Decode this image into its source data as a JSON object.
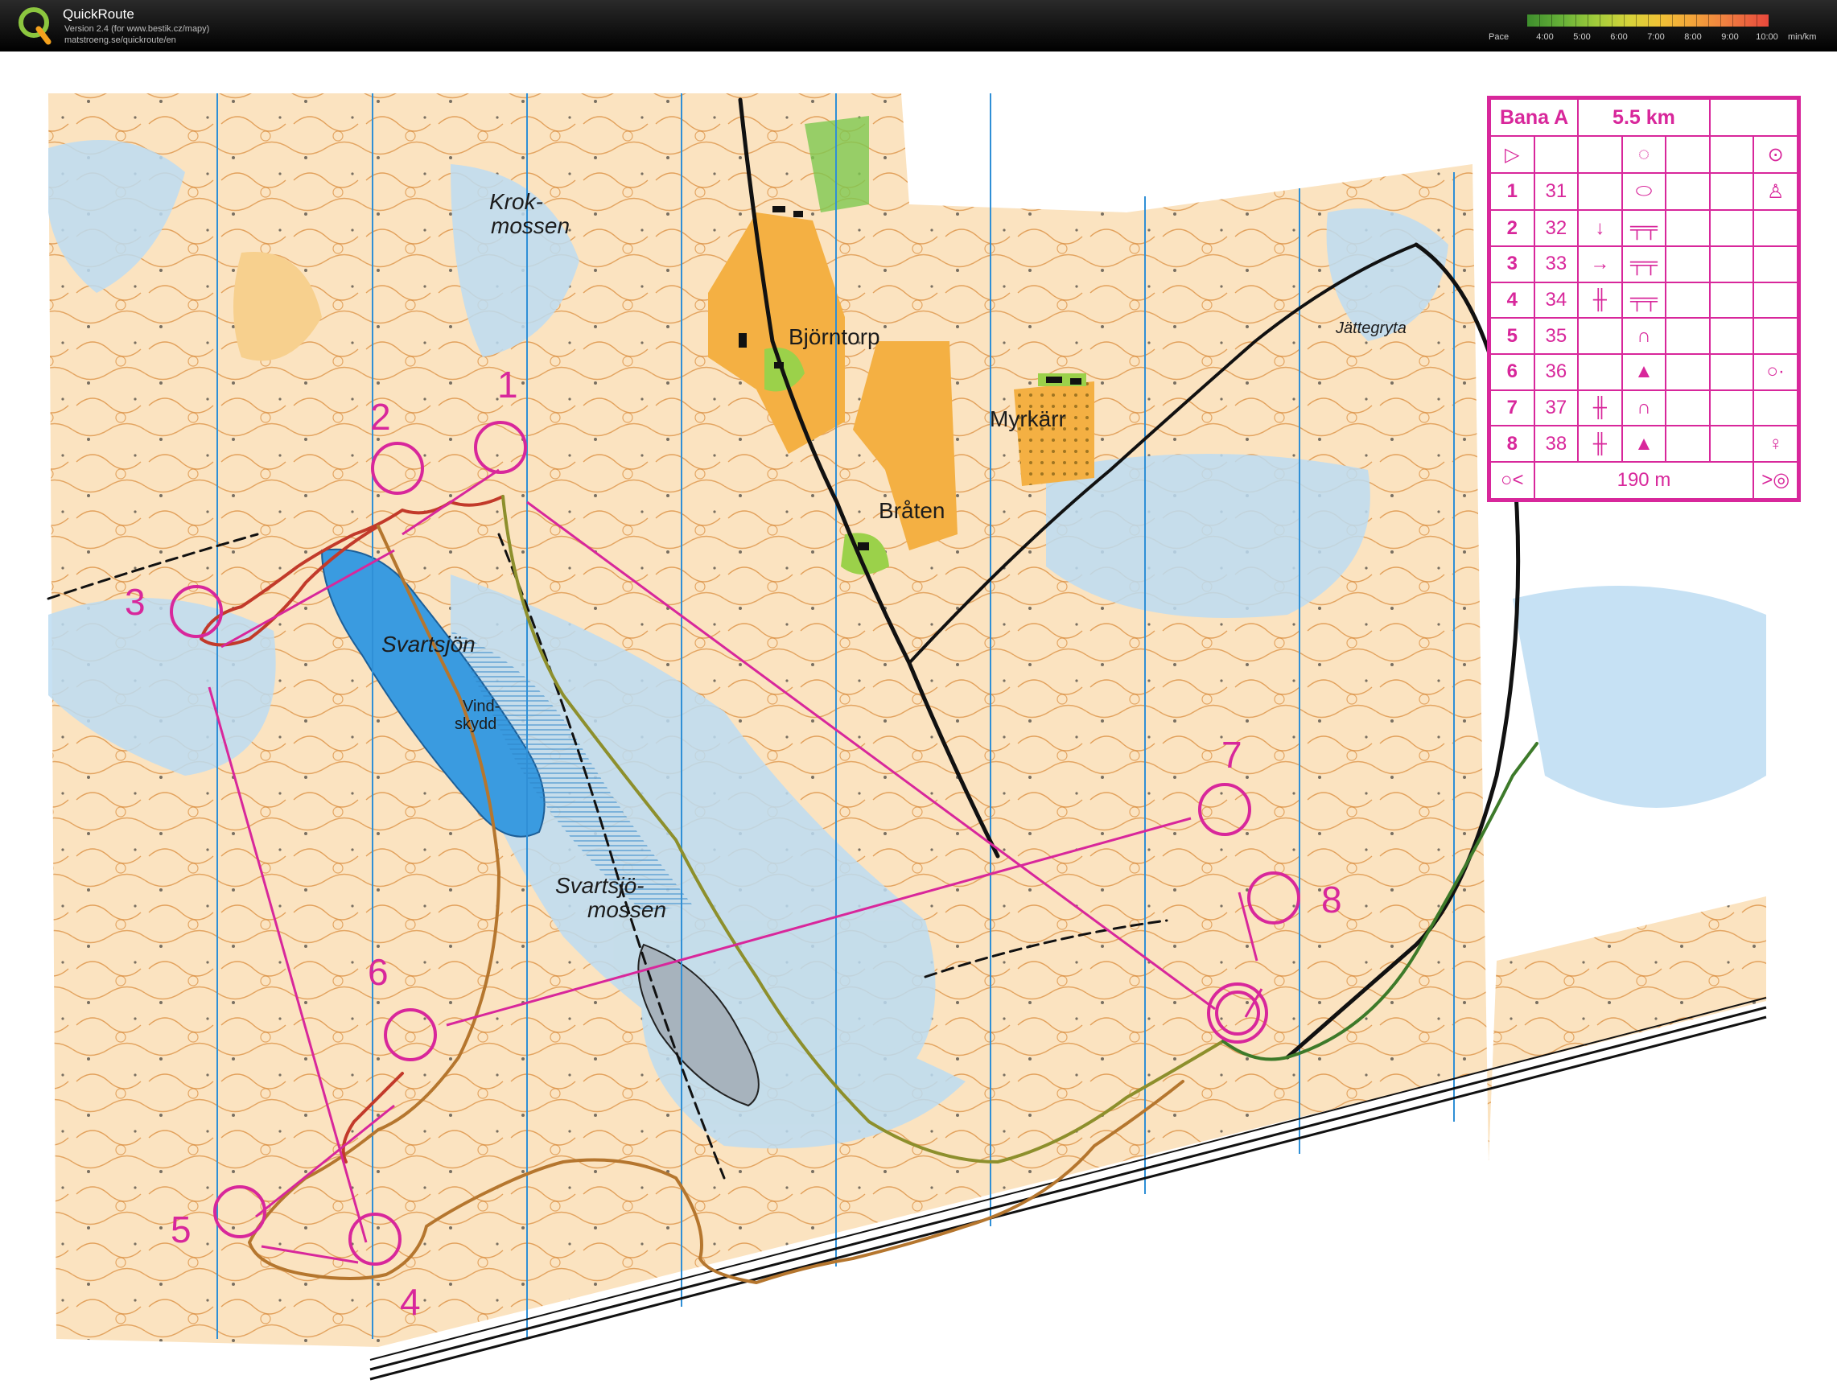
{
  "app": {
    "title": "QuickRoute",
    "version_line": "Version 2.4  (for www.bestik.cz/mapy)",
    "url_line": "matstroeng.se/quickroute/en"
  },
  "pace_legend": {
    "label": "Pace",
    "ticks": [
      "4:00",
      "5:00",
      "6:00",
      "7:00",
      "8:00",
      "9:00",
      "10:00"
    ],
    "unit": "min/km"
  },
  "map_labels": {
    "krok": "Krok-",
    "mossen": "mossen",
    "bjorntorp": "Björntorp",
    "myrkarr": "Myrkärr",
    "braten": "Bråten",
    "jattegryta": "Jättegryta",
    "svartsjon": "Svartsjön",
    "vind": "Vind-",
    "skydd": "skydd",
    "svartsjo": "Svartsjö-",
    "mossen2": "mossen"
  },
  "controls": [
    "1",
    "2",
    "3",
    "4",
    "5",
    "6",
    "7",
    "8"
  ],
  "description": {
    "course": "Bana A",
    "length": "5.5 km",
    "rows": [
      {
        "num": "1",
        "code": "31"
      },
      {
        "num": "2",
        "code": "32"
      },
      {
        "num": "3",
        "code": "33"
      },
      {
        "num": "4",
        "code": "34"
      },
      {
        "num": "5",
        "code": "35"
      },
      {
        "num": "6",
        "code": "36"
      },
      {
        "num": "7",
        "code": "37"
      },
      {
        "num": "8",
        "code": "38"
      }
    ],
    "finish_distance": "190 m"
  },
  "colors": {
    "course": "#d8279b",
    "water": "#4aa6e0",
    "field": "#f4b043",
    "contour": "#d98a3a"
  }
}
